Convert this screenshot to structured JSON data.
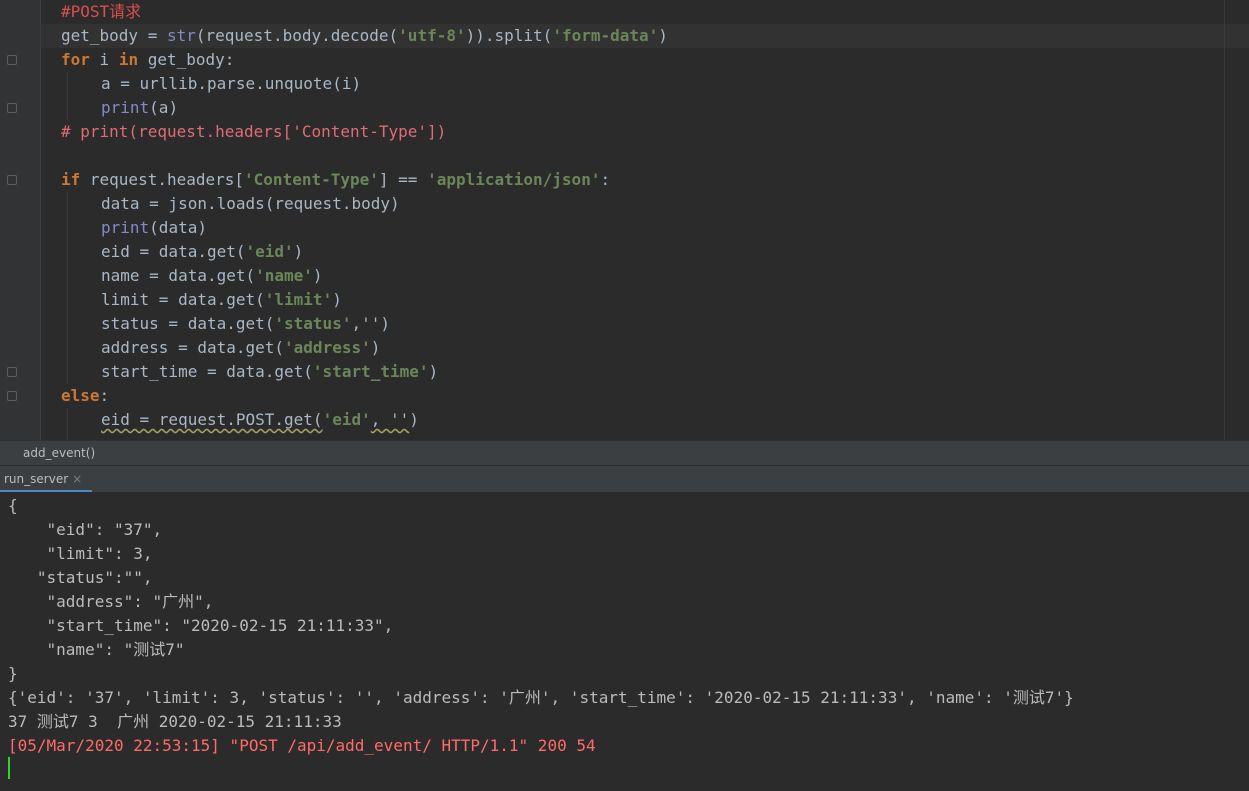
{
  "editor": {
    "title_comment": "#POST请求",
    "lines": [
      {
        "indent": 0,
        "parts": [
          [
            "t",
            "get_body = "
          ],
          [
            "bi",
            "str"
          ],
          [
            "t",
            "(request.body.decode("
          ],
          [
            "str",
            "'utf-8'"
          ],
          [
            "t",
            ")).split("
          ],
          [
            "str",
            "'form-data'"
          ],
          [
            "t",
            ")"
          ]
        ]
      },
      {
        "indent": 0,
        "parts": [
          [
            "kw",
            "for"
          ],
          [
            "t",
            " i "
          ],
          [
            "kw",
            "in"
          ],
          [
            "t",
            " get_body:"
          ]
        ]
      },
      {
        "indent": 1,
        "parts": [
          [
            "t",
            "a = urllib.parse.unquote(i)"
          ]
        ]
      },
      {
        "indent": 1,
        "parts": [
          [
            "bi",
            "print"
          ],
          [
            "t",
            "(a)"
          ]
        ]
      },
      {
        "indent": 0,
        "parts": [
          [
            "cm",
            "# print(request.headers['Content-Type'])"
          ]
        ]
      },
      {
        "indent": 0,
        "parts": []
      },
      {
        "indent": 0,
        "parts": [
          [
            "kw",
            "if"
          ],
          [
            "t",
            " request.headers["
          ],
          [
            "str",
            "'Content-Type'"
          ],
          [
            "t",
            "] == "
          ],
          [
            "str",
            "'application/json'"
          ],
          [
            "t",
            ":"
          ]
        ]
      },
      {
        "indent": 1,
        "parts": [
          [
            "t",
            "data = json.loads(request.body)"
          ]
        ]
      },
      {
        "indent": 1,
        "parts": [
          [
            "bi",
            "print"
          ],
          [
            "t",
            "(data)"
          ]
        ]
      },
      {
        "indent": 1,
        "parts": [
          [
            "t",
            "eid = data.get("
          ],
          [
            "str",
            "'eid'"
          ],
          [
            "t",
            ")"
          ]
        ]
      },
      {
        "indent": 1,
        "parts": [
          [
            "t",
            "name = data.get("
          ],
          [
            "str",
            "'name'"
          ],
          [
            "t",
            ")"
          ]
        ]
      },
      {
        "indent": 1,
        "parts": [
          [
            "t",
            "limit = data.get("
          ],
          [
            "str",
            "'limit'"
          ],
          [
            "t",
            ")"
          ]
        ]
      },
      {
        "indent": 1,
        "parts": [
          [
            "t",
            "status = data.get("
          ],
          [
            "str",
            "'status'"
          ],
          [
            "t",
            ",''"
          ],
          [
            "t",
            ")"
          ]
        ]
      },
      {
        "indent": 1,
        "parts": [
          [
            "t",
            "address = data.get("
          ],
          [
            "str",
            "'address'"
          ],
          [
            "t",
            ")"
          ]
        ]
      },
      {
        "indent": 1,
        "parts": [
          [
            "t",
            "start_time = data.get("
          ],
          [
            "str",
            "'start_time'"
          ],
          [
            "t",
            ")"
          ]
        ]
      },
      {
        "indent": 0,
        "parts": [
          [
            "kw",
            "else"
          ],
          [
            "t",
            ":"
          ]
        ]
      },
      {
        "indent": 1,
        "parts": [
          [
            "sq",
            "eid = request.POST.get("
          ],
          [
            "str",
            "'eid'"
          ],
          [
            "sq",
            ", ''"
          ],
          [
            "t",
            ")"
          ]
        ]
      }
    ]
  },
  "breadcrumb": {
    "label": "add_event()"
  },
  "run_tab": {
    "label": "run_server",
    "close": "×"
  },
  "console": {
    "lines": [
      {
        "text": "{",
        "color": "normal"
      },
      {
        "text": "    \"eid\": \"37\",",
        "color": "normal"
      },
      {
        "text": "    \"limit\": 3,",
        "color": "normal"
      },
      {
        "text": "   \"status\":\"\",",
        "color": "normal"
      },
      {
        "text": "    \"address\": \"广州\",",
        "color": "normal"
      },
      {
        "text": "    \"start_time\": \"2020-02-15 21:11:33\",",
        "color": "normal"
      },
      {
        "text": "    \"name\": \"测试7\"",
        "color": "normal"
      },
      {
        "text": "}",
        "color": "normal"
      },
      {
        "text": "{'eid': '37', 'limit': 3, 'status': '', 'address': '广州', 'start_time': '2020-02-15 21:11:33', 'name': '测试7'}",
        "color": "normal"
      },
      {
        "text": "37 测试7 3  广州 2020-02-15 21:11:33",
        "color": "normal"
      },
      {
        "text": "[05/Mar/2020 22:53:15] \"POST /api/add_event/ HTTP/1.1\" 200 54",
        "color": "error"
      }
    ]
  }
}
